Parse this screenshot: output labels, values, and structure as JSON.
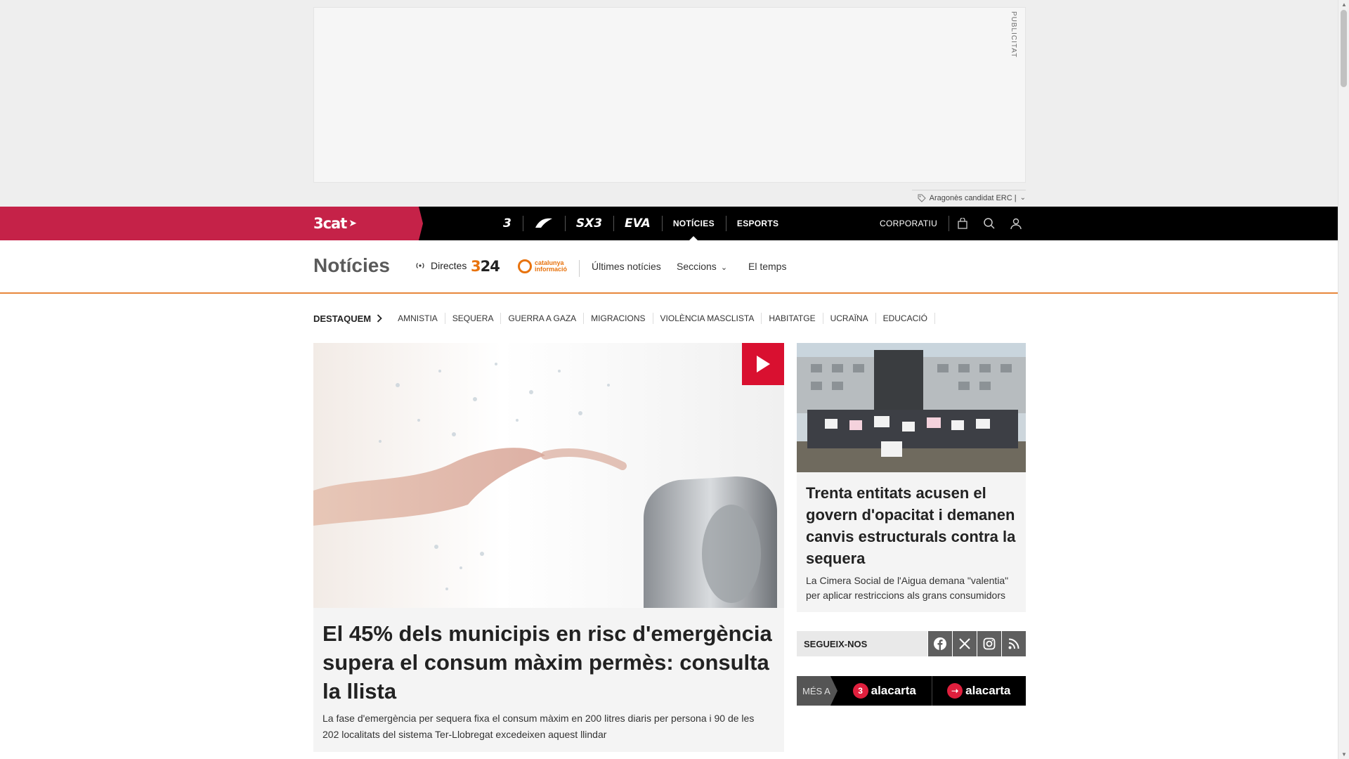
{
  "ad": {
    "label": "PUBLICITAT"
  },
  "trending": {
    "text": "Aragonès candidat ERC |"
  },
  "header": {
    "brand": "3cat",
    "channels": [
      {
        "label": "3",
        "kind": "logo"
      },
      {
        "label": "CatRàdio",
        "kind": "logo"
      },
      {
        "label": "SX3",
        "kind": "logo"
      },
      {
        "label": "EVA",
        "kind": "logo"
      },
      {
        "label": "NOTÍCIES",
        "kind": "text"
      },
      {
        "label": "ESPORTS",
        "kind": "text"
      }
    ],
    "corporate": "CORPORATIU"
  },
  "subnav": {
    "title": "Notícies",
    "directes": "Directes",
    "logo_324": "324",
    "logo_cat_line1": "catalunya",
    "logo_cat_line2": "informació",
    "links": {
      "latest": "Últimes notícies",
      "sections": "Seccions",
      "weather": "El temps"
    }
  },
  "topics": {
    "lead": "DESTAQUEM",
    "items": [
      "AMNISTIA",
      "SEQUERA",
      "GUERRA A GAZA",
      "MIGRACIONS",
      "VIOLÈNCIA MASCLISTA",
      "HABITATGE",
      "UCRAÏNA",
      "EDUCACIÓ"
    ]
  },
  "lead_story": {
    "title": "El 45% dels municipis en risc d'emergència supera el consum màxim permès: consulta la llista",
    "subtitle": "La fase d'emergència per sequera fixa el consum màxim en 200 litres diaris per persona i 90 de les 202 localitats del sistema Ter-Llobregat excedeixen aquest llindar"
  },
  "side_story": {
    "title": "Trenta entitats acusen el govern d'opacitat i demanen canvis estructurals contra la sequera",
    "subtitle": "La Cimera Social de l'Aigua demana \"valentia\" per aplicar restriccions als grans consumidors"
  },
  "follow": {
    "label": "SEGUEIX-NOS",
    "networks": [
      "facebook-icon",
      "x-icon",
      "instagram-icon",
      "rss-icon"
    ]
  },
  "alacarta": {
    "prefix": "MÉS A",
    "items": [
      {
        "badge": "3",
        "label": "alacarta"
      },
      {
        "badge": "➝",
        "label": "alacarta"
      }
    ]
  },
  "colors": {
    "brand_red": "#c52248",
    "accent_orange": "#e8873b",
    "play_red": "#d91030"
  }
}
